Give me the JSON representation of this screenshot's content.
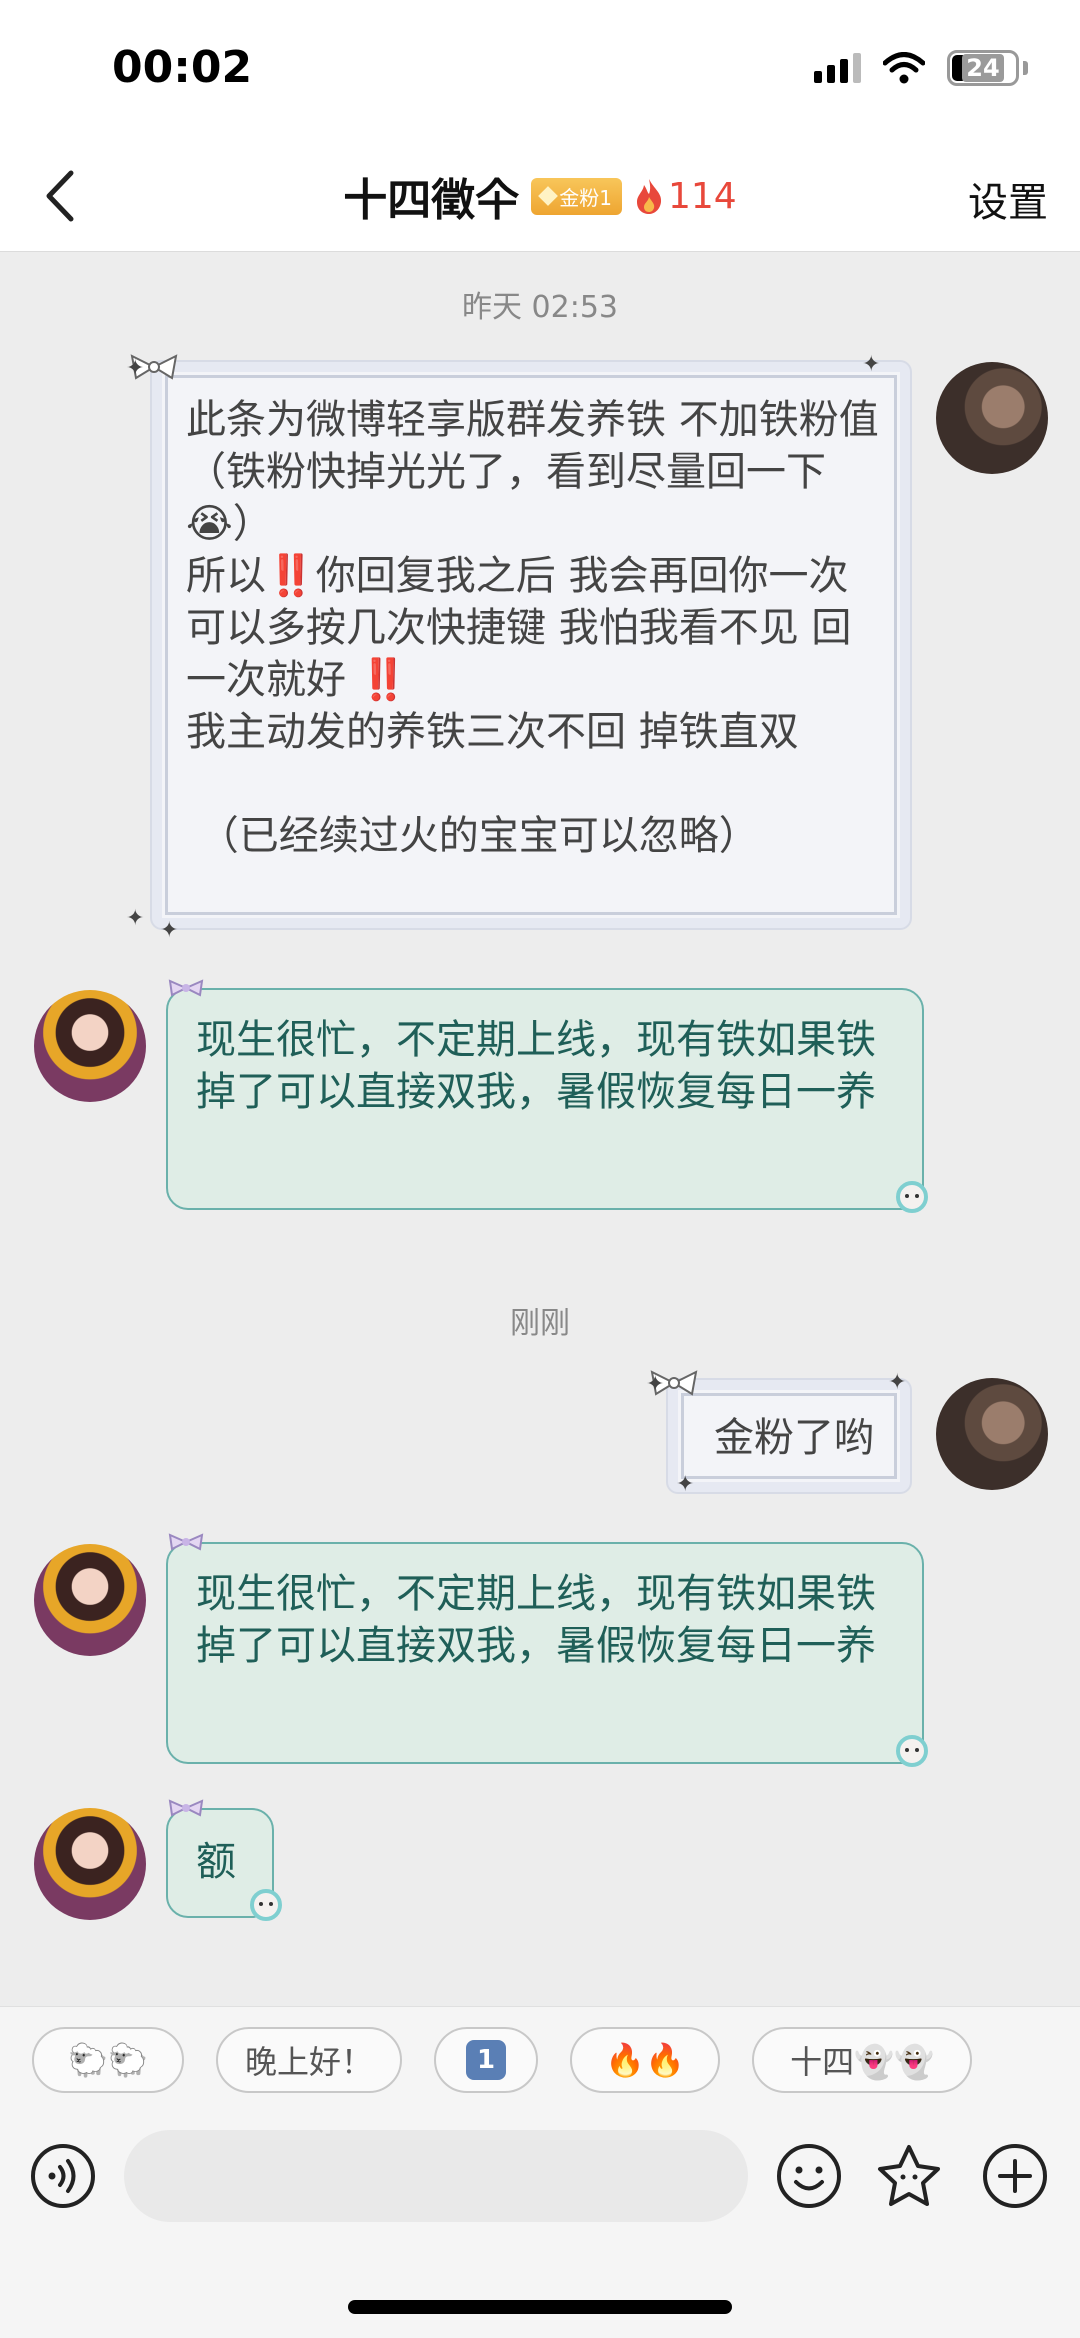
{
  "status_bar": {
    "time": "00:02",
    "battery": "24"
  },
  "nav": {
    "title": "十四徵仐",
    "badge": "金粉1",
    "flame_count": "114",
    "settings_label": "设置"
  },
  "timestamps": [
    "昨天 02:53",
    "刚刚"
  ],
  "messages": [
    {
      "sender": "me",
      "text": "此条为微博轻享版群发养铁 不加铁粉值（铁粉快掉光光了，看到尽量回一下😭）\n所以‼️你回复我之后 我会再回你一次 可以多按几次快捷键 我怕我看不见 回一次就好 ‼️\n我主动发的养铁三次不回 掉铁直双\n\n （已经续过火的宝宝可以忽略）"
    },
    {
      "sender": "her",
      "text": "现生很忙，不定期上线，现有铁如果铁掉了可以直接双我，暑假恢复每日一养"
    },
    {
      "sender": "me",
      "text": "金粉了哟"
    },
    {
      "sender": "her",
      "text": "现生很忙，不定期上线，现有铁如果铁掉了可以直接双我，暑假恢复每日一养"
    },
    {
      "sender": "her",
      "text": "额"
    }
  ],
  "quick_replies": [
    "🐑🐑",
    "晚上好！",
    "1",
    "🔥🔥",
    "十四👻👻"
  ],
  "input": {
    "placeholder": "",
    "value": ""
  },
  "colors": {
    "accent_flame": "#e8483b",
    "bubble_green": "#dfede6",
    "bubble_green_border": "#6ab1ab",
    "badge_gold": "#eea531"
  },
  "icons": [
    "back-chevron-icon",
    "flame-icon",
    "voice-icon",
    "emoji-icon",
    "sticker-icon",
    "plus-icon",
    "wifi-icon",
    "signal-icon",
    "battery-icon"
  ]
}
